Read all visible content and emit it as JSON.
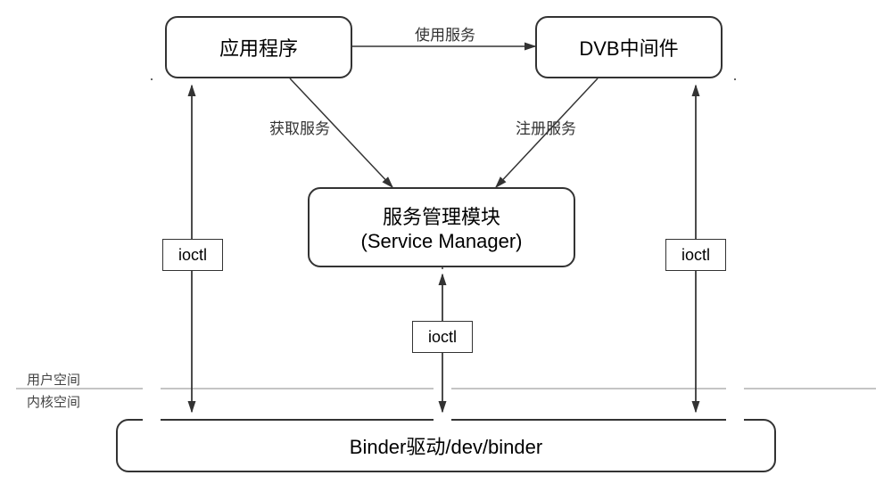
{
  "boxes": {
    "app": "应用程序",
    "dvb": "DVB中间件",
    "svcmgr_line1": "服务管理模块",
    "svcmgr_line2": "(Service Manager)",
    "binder": "Binder驱动/dev/binder"
  },
  "edges": {
    "use_service": "使用服务",
    "get_service": "获取服务",
    "register_service": "注册服务"
  },
  "ioctl": {
    "left": "ioctl",
    "center": "ioctl",
    "right": "ioctl"
  },
  "zones": {
    "user": "用户空间",
    "kernel": "内核空间"
  }
}
